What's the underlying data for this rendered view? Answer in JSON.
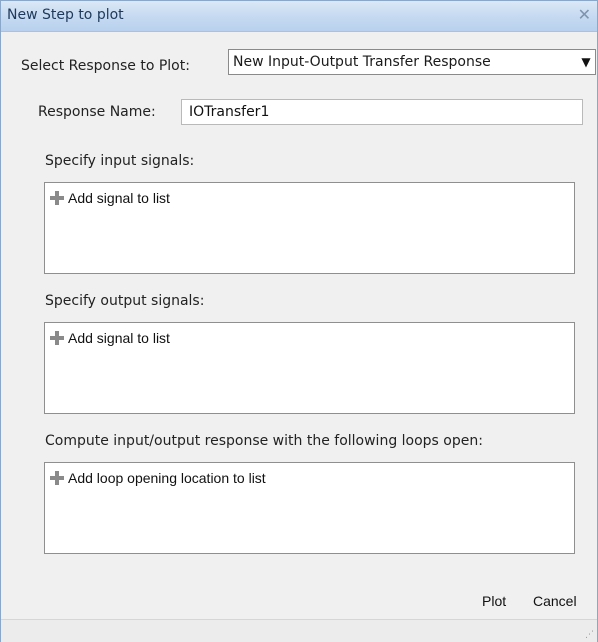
{
  "window": {
    "title": "New Step to plot",
    "close_glyph": "✕"
  },
  "response_select": {
    "label": "Select Response to Plot:",
    "value": "New Input-Output Transfer Response"
  },
  "response_name": {
    "label": "Response Name:",
    "value": "IOTransfer1"
  },
  "input_signals": {
    "label": "Specify input signals:",
    "add_label": "Add signal to list"
  },
  "output_signals": {
    "label": "Specify output signals:",
    "add_label": "Add signal to list"
  },
  "loops_open": {
    "label": "Compute input/output response with the following loops open:",
    "add_label": "Add loop opening location to list"
  },
  "buttons": {
    "plot": "Plot",
    "cancel": "Cancel"
  },
  "icons": [
    "close-icon",
    "chevron-down-icon",
    "plus-icon",
    "resize-grip-icon"
  ]
}
